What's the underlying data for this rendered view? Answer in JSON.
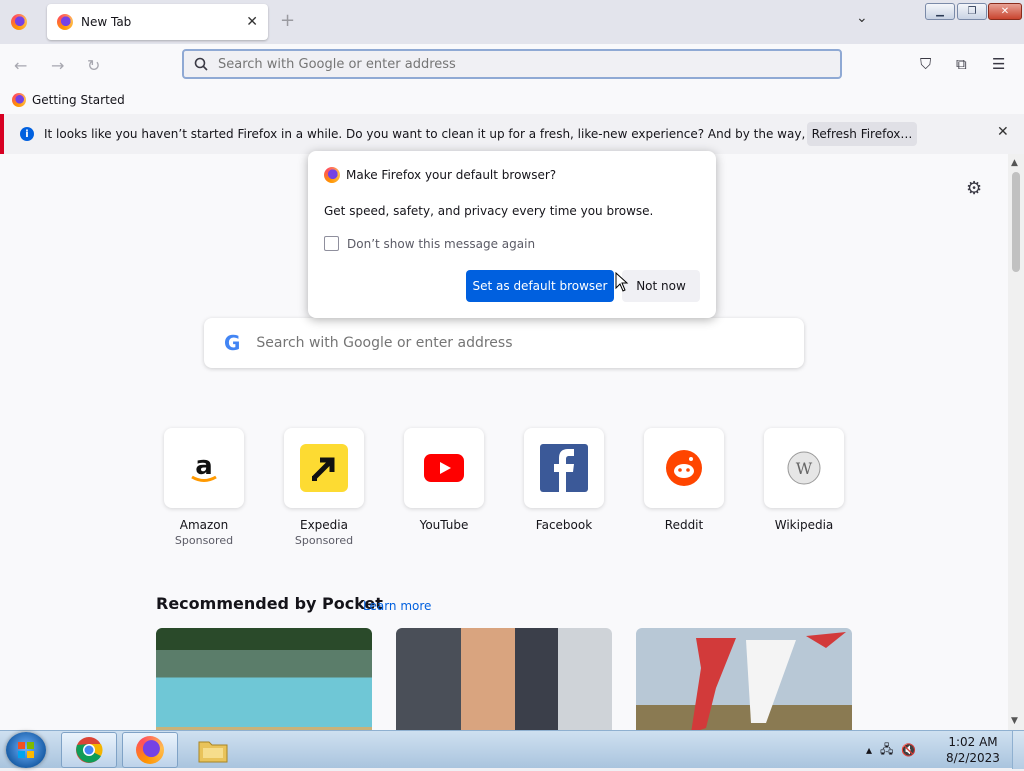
{
  "browser": {
    "tab": {
      "label": "New Tab"
    },
    "url_placeholder": "Search with Google or enter address",
    "bookmarks": [
      {
        "label": "Getting Started"
      }
    ],
    "notification": {
      "message": "It looks like you haven’t started Firefox in a while. Do you want to clean it up for a fresh, like-new experience? And by the way, welcome back!",
      "button_label": "Refresh Firefox…"
    }
  },
  "newtab": {
    "search_placeholder": "Search with Google or enter address",
    "top_sites": [
      {
        "name": "Amazon",
        "sponsored": "Sponsored",
        "icon": "amazon-icon"
      },
      {
        "name": "Expedia",
        "sponsored": "Sponsored",
        "icon": "expedia-icon"
      },
      {
        "name": "YouTube",
        "sponsored": "",
        "icon": "youtube-icon"
      },
      {
        "name": "Facebook",
        "sponsored": "",
        "icon": "facebook-icon"
      },
      {
        "name": "Reddit",
        "sponsored": "",
        "icon": "reddit-icon"
      },
      {
        "name": "Wikipedia",
        "sponsored": "",
        "icon": "wikipedia-icon"
      }
    ],
    "pocket": {
      "title": "Recommended by Pocket",
      "learn_more": "Learn more"
    }
  },
  "modal": {
    "title": "Make Firefox your default browser?",
    "body": "Get speed, safety, and privacy every time you browse.",
    "checkbox_label": "Don’t show this message again",
    "primary_button": "Set as default browser",
    "secondary_button": "Not now"
  },
  "taskbar": {
    "time": "1:02 AM",
    "date": "8/2/2023"
  },
  "colors": {
    "accent": "#0060df",
    "notification_bar": "#d70022"
  }
}
